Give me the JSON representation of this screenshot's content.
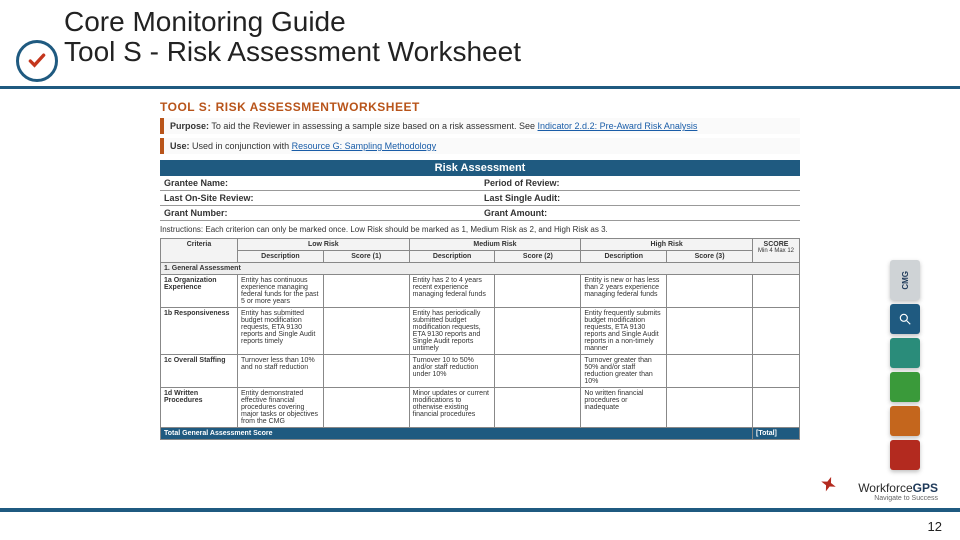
{
  "header": {
    "line1": "Core Monitoring Guide",
    "line2": "Tool S - Risk Assessment Worksheet"
  },
  "doc": {
    "title": "TOOL S: RISK ASSESSMENTWORKSHEET",
    "purpose_label": "Purpose:",
    "purpose_text": "To aid the Reviewer in assessing a sample size based on a risk assessment. See ",
    "purpose_link": "Indicator 2.d.2: Pre-Award Risk Analysis",
    "use_label": "Use:",
    "use_text": "Used in conjunction with ",
    "use_link": "Resource G: Sampling Methodology",
    "ra_header": "Risk Assessment",
    "meta": {
      "grantee_label": "Grantee Name:",
      "period_label": "Period of Review:",
      "lastreview_label": "Last On-Site Review:",
      "audit_label": "Last Single Audit:",
      "grantno_label": "Grant Number:",
      "amount_label": "Grant Amount:"
    },
    "instructions": "Instructions: Each criterion can only be marked once. Low Risk should be marked as 1, Medium Risk as 2, and High Risk as 3.",
    "cols": {
      "criteria": "Criteria",
      "low": "Low Risk",
      "med": "Medium Risk",
      "high": "High Risk",
      "desc": "Description",
      "s1": "Score (1)",
      "s2": "Score (2)",
      "s3": "Score (3)",
      "scorecol": "SCORE",
      "scorehint": "Min 4 Max 12"
    },
    "section1": "1. General Assessment",
    "rows": [
      {
        "id": "1a",
        "name": "Organization Experience",
        "low": "Entity has continuous experience managing federal funds for the past 5 or more years",
        "med": "Entity has 2 to 4 years recent experience managing federal funds",
        "high": "Entity is new or has less than 2 years experience managing federal funds"
      },
      {
        "id": "1b",
        "name": "Responsiveness",
        "low": "Entity has submitted budget modification requests, ETA 9130 reports and Single Audit reports timely",
        "med": "Entity has periodically submitted budget modification requests, ETA 9130 reports and Single Audit reports untimely",
        "high": "Entity frequently submits budget modification requests, ETA 9130 reports and Single Audit reports in a non-timely manner"
      },
      {
        "id": "1c",
        "name": "Overall Staffing",
        "low": "Turnover less than 10% and no staff reduction",
        "med": "Turnover 10 to 50% and/or staff reduction under 10%",
        "high": "Turnover greater than 50% and/or staff reduction greater than 10%"
      },
      {
        "id": "1d",
        "name": "Written Procedures",
        "low": "Entity demonstrated effective financial procedures covering major tasks or objectives from the CMG",
        "med": "Minor updates or current modifications to otherwise existing financial procedures",
        "high": "No written financial procedures or inadequate"
      }
    ],
    "total_label": "Total General Assessment Score",
    "total_cell": "[Total]"
  },
  "sidebar": {
    "cmg": "CMG"
  },
  "logo": {
    "brand_a": "Workforce",
    "brand_b": "GPS",
    "tag": "Navigate to Success"
  },
  "page_number": "12"
}
